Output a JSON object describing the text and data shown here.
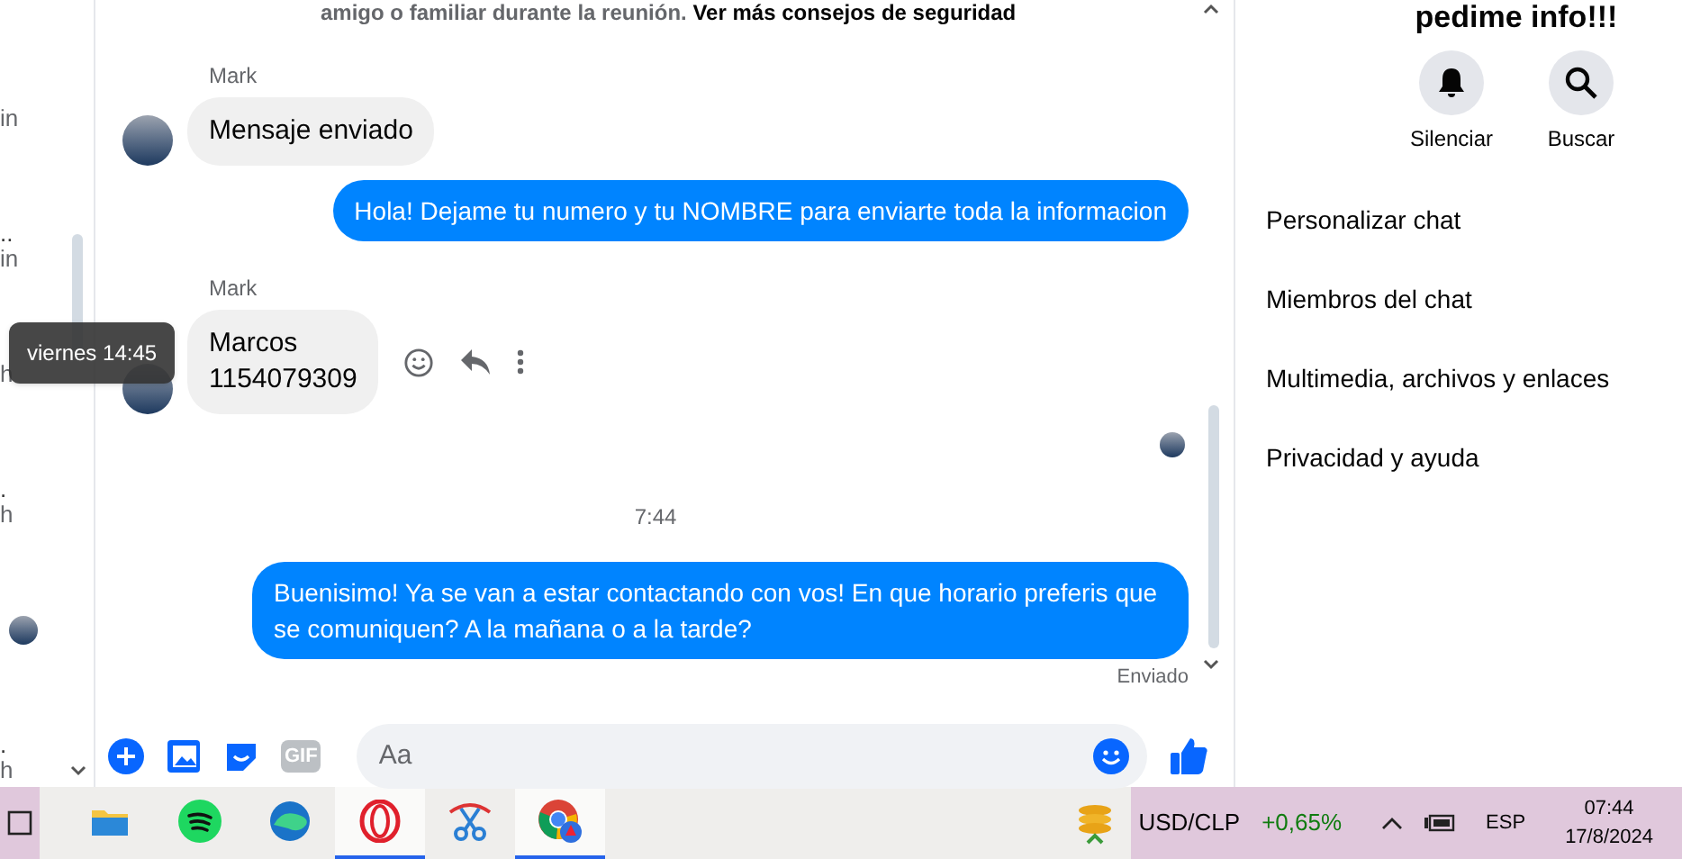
{
  "sidebar": {
    "items": [
      {
        "time": "in"
      },
      {
        "preview": "..",
        "time": "in"
      },
      {
        "time": "h"
      },
      {
        "preview": ".",
        "time": "h"
      },
      {
        "avatar": true
      },
      {
        "preview": ".",
        "time": "h"
      }
    ]
  },
  "tooltip": {
    "text": "viernes 14:45"
  },
  "chat": {
    "notice": {
      "text": "amigo o familiar durante la reunión.",
      "link": "Ver más consejos de seguridad"
    },
    "messages": [
      {
        "kind": "received",
        "sender": "Mark",
        "lines": [
          "Mensaje enviado"
        ],
        "hovered": false
      },
      {
        "kind": "sent",
        "text": "Hola! Dejame tu numero y tu NOMBRE para enviarte toda la informacion"
      },
      {
        "kind": "received",
        "sender": "Mark",
        "lines": [
          "Marcos",
          "1154079309"
        ],
        "hovered": true
      },
      {
        "kind": "seen"
      },
      {
        "kind": "timestamp",
        "text": "7:44"
      },
      {
        "kind": "sent",
        "text": "Buenisimo! Ya se van a estar contactando con vos! En que horario preferis que se comuniquen? A la mañana o a la tarde?",
        "status": "Enviado"
      }
    ],
    "composer": {
      "placeholder": "Aa",
      "gif": "GIF"
    }
  },
  "details": {
    "title": "pedime info!!!",
    "actions": [
      {
        "kind": "mute",
        "label": "Silenciar"
      },
      {
        "kind": "search",
        "label": "Buscar"
      }
    ],
    "menu": [
      "Personalizar chat",
      "Miembros del chat",
      "Multimedia, archivos y enlaces",
      "Privacidad y ayuda"
    ]
  },
  "taskbar": {
    "apps": [
      {
        "kind": "files",
        "active": false
      },
      {
        "kind": "music",
        "active": false
      },
      {
        "kind": "browser-wave",
        "active": false
      },
      {
        "kind": "ring",
        "active": true
      },
      {
        "kind": "scissors",
        "active": false
      },
      {
        "kind": "chrome",
        "active": true
      }
    ],
    "ticker": {
      "symbol": "USD/CLP",
      "change": "+0,65%"
    },
    "language": "ESP",
    "time": "07:44",
    "date": "17/8/2024"
  }
}
